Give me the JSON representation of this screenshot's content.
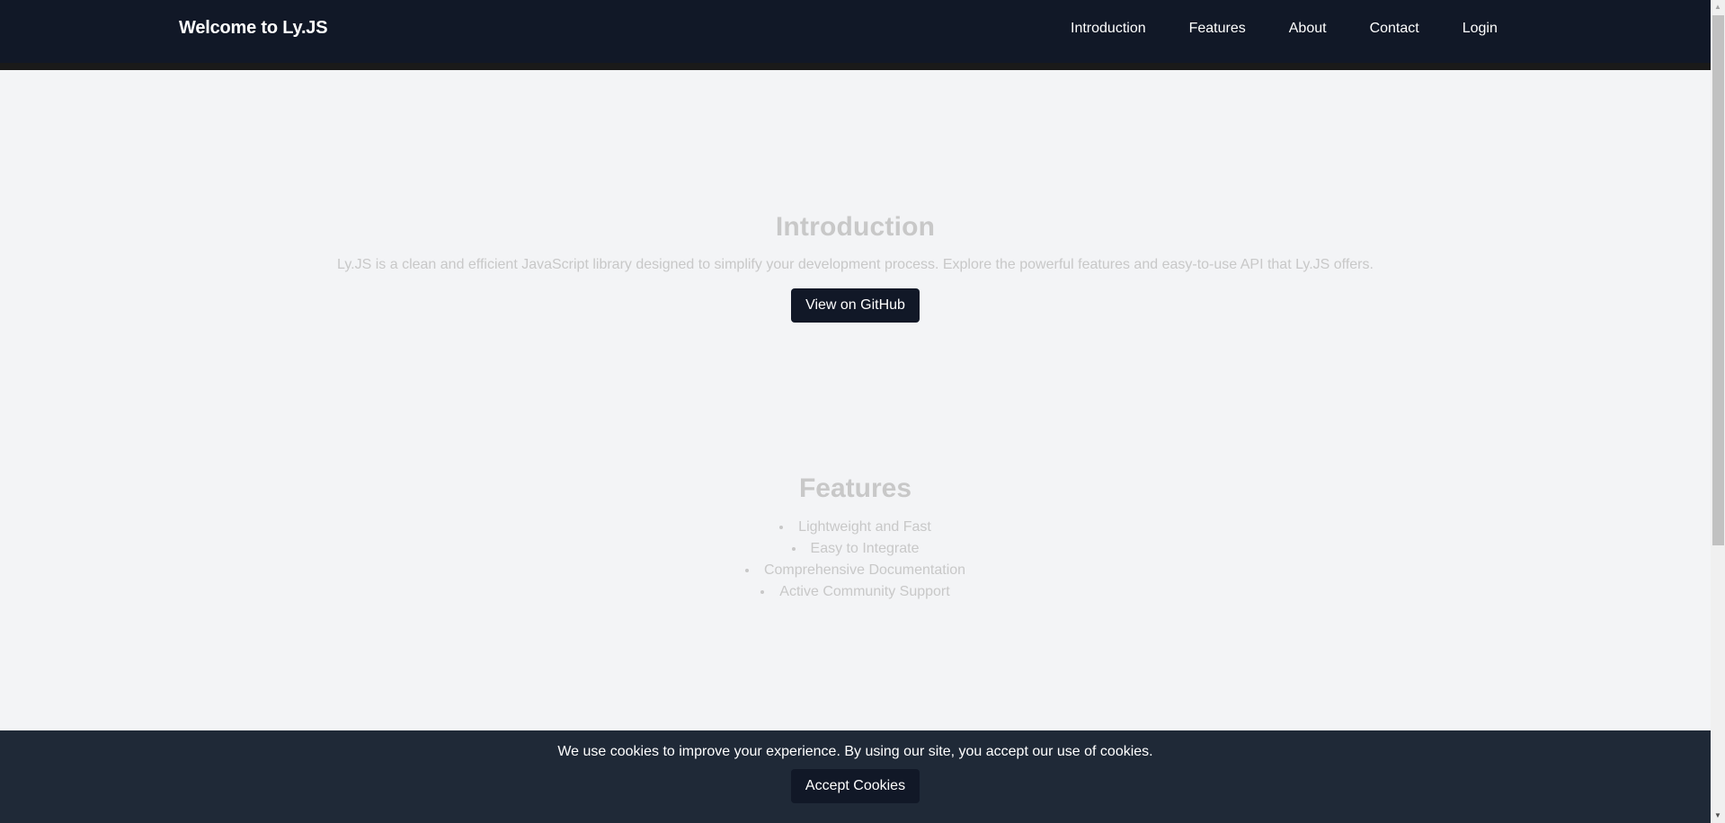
{
  "header": {
    "brand": "Welcome to Ly.JS",
    "nav": [
      {
        "label": "Introduction"
      },
      {
        "label": "Features"
      },
      {
        "label": "About"
      },
      {
        "label": "Contact"
      },
      {
        "label": "Login"
      }
    ]
  },
  "intro": {
    "title": "Introduction",
    "description": "Ly.JS is a clean and efficient JavaScript library designed to simplify your development process. Explore the powerful features and easy-to-use API that Ly.JS offers.",
    "button_label": "View on GitHub"
  },
  "features": {
    "title": "Features",
    "items": [
      "Lightweight and Fast",
      "Easy to Integrate",
      "Comprehensive Documentation",
      "Active Community Support"
    ]
  },
  "cookie_banner": {
    "message": "We use cookies to improve your experience. By using our site, you accept our use of cookies.",
    "button_label": "Accept Cookies"
  },
  "scrollbar": {
    "up_icon": "▲",
    "down_icon": "▼"
  },
  "colors": {
    "header_bg": "#111827",
    "page_bg": "#f3f4f6",
    "muted_text": "#c8c8c8",
    "banner_bg": "#1f2937",
    "button_bg": "#111827"
  }
}
